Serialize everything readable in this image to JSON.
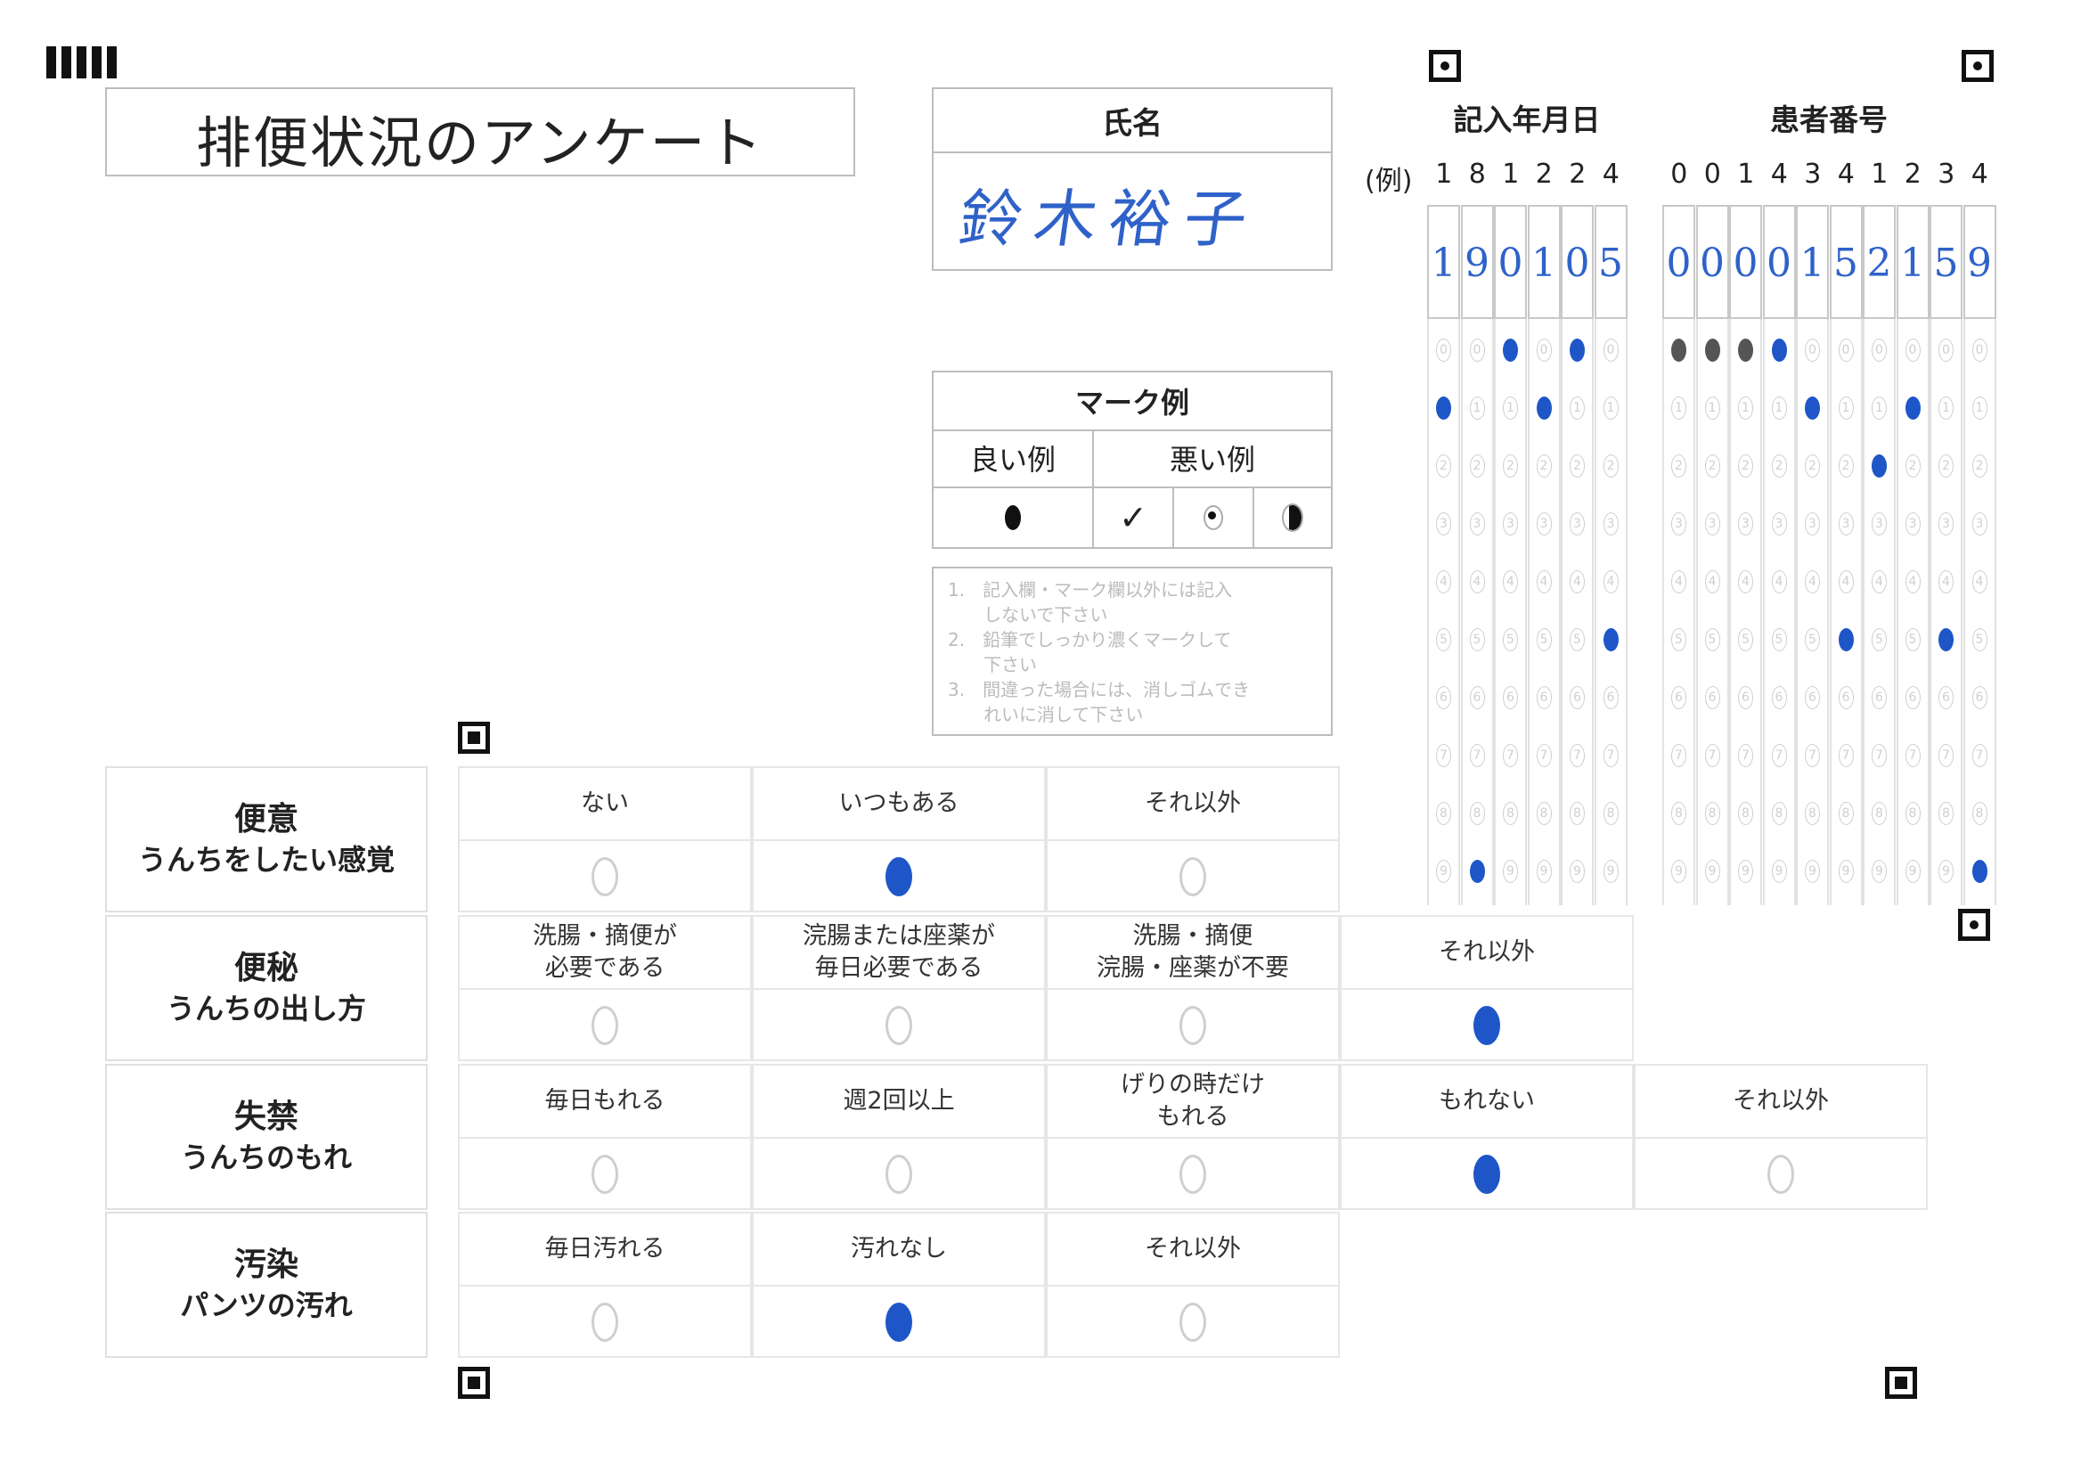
{
  "title": "排便状況のアンケート",
  "name_box": {
    "label": "氏名",
    "handwritten": "鈴木裕子"
  },
  "date_box": {
    "label": "記入年月日",
    "example_prefix": "(例)",
    "example_digits": [
      "1",
      "8",
      "1",
      "2",
      "2",
      "4"
    ],
    "handwritten": [
      "1",
      "9",
      "0",
      "1",
      "0",
      "5"
    ],
    "marked": [
      1,
      9,
      0,
      1,
      0,
      5
    ]
  },
  "patient_box": {
    "label": "患者番号",
    "example_digits": [
      "0",
      "0",
      "1",
      "4",
      "3",
      "4",
      "1",
      "2",
      "3",
      "4"
    ],
    "handwritten": [
      "0",
      "0",
      "0",
      "0",
      "1",
      "5",
      "2",
      "1",
      "5",
      "9"
    ],
    "marked": [
      0,
      0,
      0,
      0,
      1,
      5,
      2,
      1,
      5,
      9
    ],
    "pencil_cols": [
      0,
      1,
      2
    ]
  },
  "mark_example": {
    "title": "マーク例",
    "good_label": "良い例",
    "bad_label": "悪い例",
    "check_glyph": "✓"
  },
  "notes": [
    "1.　記入欄・マーク欄以外には記入",
    "　　しないで下さい",
    "2.　鉛筆でしっかり濃くマークして",
    "　　下さい",
    "3.　間違った場合には、消しゴムでき",
    "　　れいに消して下さい"
  ],
  "questions": [
    {
      "title": "便意",
      "subtitle": "うんちをしたい感覚",
      "options": [
        "ない",
        "いつもある",
        "それ以外"
      ],
      "selected": 1
    },
    {
      "title": "便秘",
      "subtitle": "うんちの出し方",
      "options": [
        "洗腸・摘便が\n必要である",
        "浣腸または座薬が\n毎日必要である",
        "洗腸・摘便\n浣腸・座薬が不要",
        "それ以外"
      ],
      "selected": 3
    },
    {
      "title": "失禁",
      "subtitle": "うんちのもれ",
      "options": [
        "毎日もれる",
        "週2回以上",
        "げりの時だけ\nもれる",
        "もれない",
        "それ以外"
      ],
      "selected": 3
    },
    {
      "title": "汚染",
      "subtitle": "パンツの汚れ",
      "options": [
        "毎日汚れる",
        "汚れなし",
        "それ以外"
      ],
      "selected": 1
    }
  ]
}
